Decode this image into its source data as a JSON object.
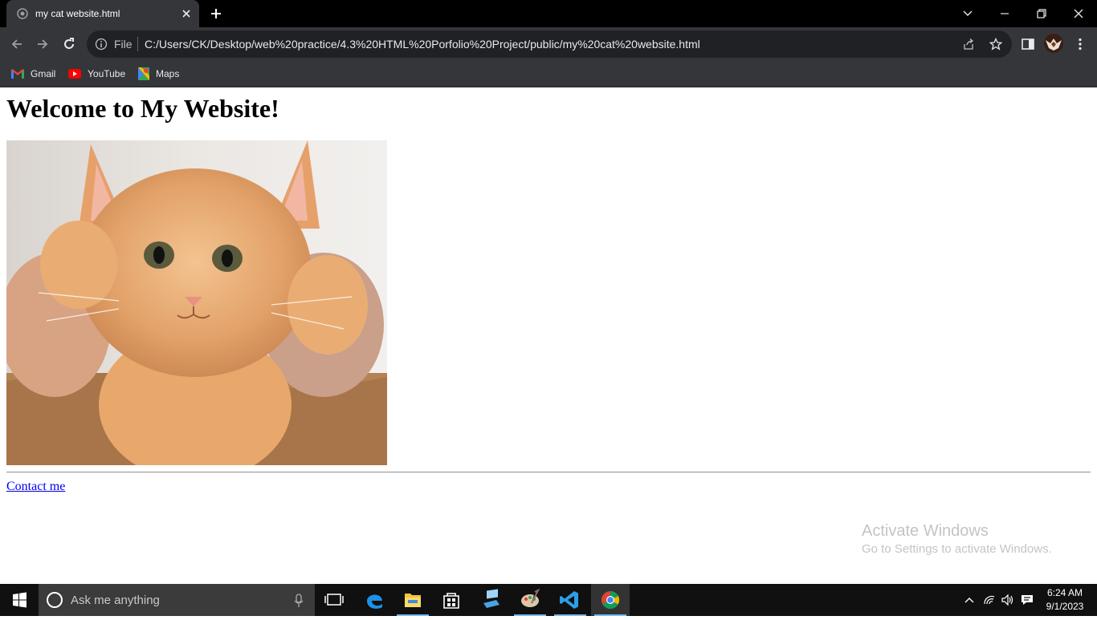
{
  "browser": {
    "tab": {
      "title": "my cat website.html"
    },
    "address": {
      "scheme": "File",
      "url": "C:/Users/CK/Desktop/web%20practice/4.3%20HTML%20Porfolio%20Project/public/my%20cat%20website.html"
    },
    "bookmarks": [
      {
        "label": "Gmail",
        "icon": "gmail-icon"
      },
      {
        "label": "YouTube",
        "icon": "youtube-icon"
      },
      {
        "label": "Maps",
        "icon": "maps-icon"
      }
    ]
  },
  "page": {
    "heading": "Welcome to My Website!",
    "link": "Contact me"
  },
  "watermark": {
    "line1": "Activate Windows",
    "line2": "Go to Settings to activate Windows."
  },
  "taskbar": {
    "search_placeholder": "Ask me anything",
    "time": "6:24 AM",
    "date": "9/1/2023"
  },
  "colors": {
    "tab_strip": "#000000",
    "toolbar": "#35363a",
    "omnibox": "#202124",
    "link": "#0000ee",
    "taskbar": "#101010",
    "taskbar_indicator": "#76b9ed"
  }
}
